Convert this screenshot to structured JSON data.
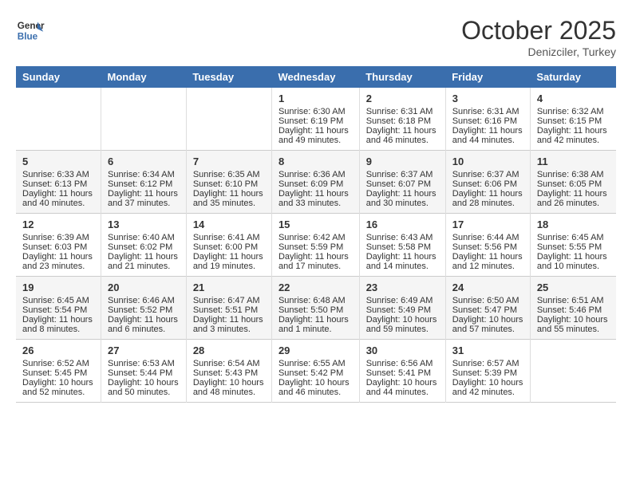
{
  "header": {
    "logo_line1": "General",
    "logo_line2": "Blue",
    "month": "October 2025",
    "location": "Denizciler, Turkey"
  },
  "days_of_week": [
    "Sunday",
    "Monday",
    "Tuesday",
    "Wednesday",
    "Thursday",
    "Friday",
    "Saturday"
  ],
  "weeks": [
    [
      {
        "day": "",
        "sunrise": "",
        "sunset": "",
        "daylight": ""
      },
      {
        "day": "",
        "sunrise": "",
        "sunset": "",
        "daylight": ""
      },
      {
        "day": "",
        "sunrise": "",
        "sunset": "",
        "daylight": ""
      },
      {
        "day": "1",
        "sunrise": "Sunrise: 6:30 AM",
        "sunset": "Sunset: 6:19 PM",
        "daylight": "Daylight: 11 hours and 49 minutes."
      },
      {
        "day": "2",
        "sunrise": "Sunrise: 6:31 AM",
        "sunset": "Sunset: 6:18 PM",
        "daylight": "Daylight: 11 hours and 46 minutes."
      },
      {
        "day": "3",
        "sunrise": "Sunrise: 6:31 AM",
        "sunset": "Sunset: 6:16 PM",
        "daylight": "Daylight: 11 hours and 44 minutes."
      },
      {
        "day": "4",
        "sunrise": "Sunrise: 6:32 AM",
        "sunset": "Sunset: 6:15 PM",
        "daylight": "Daylight: 11 hours and 42 minutes."
      }
    ],
    [
      {
        "day": "5",
        "sunrise": "Sunrise: 6:33 AM",
        "sunset": "Sunset: 6:13 PM",
        "daylight": "Daylight: 11 hours and 40 minutes."
      },
      {
        "day": "6",
        "sunrise": "Sunrise: 6:34 AM",
        "sunset": "Sunset: 6:12 PM",
        "daylight": "Daylight: 11 hours and 37 minutes."
      },
      {
        "day": "7",
        "sunrise": "Sunrise: 6:35 AM",
        "sunset": "Sunset: 6:10 PM",
        "daylight": "Daylight: 11 hours and 35 minutes."
      },
      {
        "day": "8",
        "sunrise": "Sunrise: 6:36 AM",
        "sunset": "Sunset: 6:09 PM",
        "daylight": "Daylight: 11 hours and 33 minutes."
      },
      {
        "day": "9",
        "sunrise": "Sunrise: 6:37 AM",
        "sunset": "Sunset: 6:07 PM",
        "daylight": "Daylight: 11 hours and 30 minutes."
      },
      {
        "day": "10",
        "sunrise": "Sunrise: 6:37 AM",
        "sunset": "Sunset: 6:06 PM",
        "daylight": "Daylight: 11 hours and 28 minutes."
      },
      {
        "day": "11",
        "sunrise": "Sunrise: 6:38 AM",
        "sunset": "Sunset: 6:05 PM",
        "daylight": "Daylight: 11 hours and 26 minutes."
      }
    ],
    [
      {
        "day": "12",
        "sunrise": "Sunrise: 6:39 AM",
        "sunset": "Sunset: 6:03 PM",
        "daylight": "Daylight: 11 hours and 23 minutes."
      },
      {
        "day": "13",
        "sunrise": "Sunrise: 6:40 AM",
        "sunset": "Sunset: 6:02 PM",
        "daylight": "Daylight: 11 hours and 21 minutes."
      },
      {
        "day": "14",
        "sunrise": "Sunrise: 6:41 AM",
        "sunset": "Sunset: 6:00 PM",
        "daylight": "Daylight: 11 hours and 19 minutes."
      },
      {
        "day": "15",
        "sunrise": "Sunrise: 6:42 AM",
        "sunset": "Sunset: 5:59 PM",
        "daylight": "Daylight: 11 hours and 17 minutes."
      },
      {
        "day": "16",
        "sunrise": "Sunrise: 6:43 AM",
        "sunset": "Sunset: 5:58 PM",
        "daylight": "Daylight: 11 hours and 14 minutes."
      },
      {
        "day": "17",
        "sunrise": "Sunrise: 6:44 AM",
        "sunset": "Sunset: 5:56 PM",
        "daylight": "Daylight: 11 hours and 12 minutes."
      },
      {
        "day": "18",
        "sunrise": "Sunrise: 6:45 AM",
        "sunset": "Sunset: 5:55 PM",
        "daylight": "Daylight: 11 hours and 10 minutes."
      }
    ],
    [
      {
        "day": "19",
        "sunrise": "Sunrise: 6:45 AM",
        "sunset": "Sunset: 5:54 PM",
        "daylight": "Daylight: 11 hours and 8 minutes."
      },
      {
        "day": "20",
        "sunrise": "Sunrise: 6:46 AM",
        "sunset": "Sunset: 5:52 PM",
        "daylight": "Daylight: 11 hours and 6 minutes."
      },
      {
        "day": "21",
        "sunrise": "Sunrise: 6:47 AM",
        "sunset": "Sunset: 5:51 PM",
        "daylight": "Daylight: 11 hours and 3 minutes."
      },
      {
        "day": "22",
        "sunrise": "Sunrise: 6:48 AM",
        "sunset": "Sunset: 5:50 PM",
        "daylight": "Daylight: 11 hours and 1 minute."
      },
      {
        "day": "23",
        "sunrise": "Sunrise: 6:49 AM",
        "sunset": "Sunset: 5:49 PM",
        "daylight": "Daylight: 10 hours and 59 minutes."
      },
      {
        "day": "24",
        "sunrise": "Sunrise: 6:50 AM",
        "sunset": "Sunset: 5:47 PM",
        "daylight": "Daylight: 10 hours and 57 minutes."
      },
      {
        "day": "25",
        "sunrise": "Sunrise: 6:51 AM",
        "sunset": "Sunset: 5:46 PM",
        "daylight": "Daylight: 10 hours and 55 minutes."
      }
    ],
    [
      {
        "day": "26",
        "sunrise": "Sunrise: 6:52 AM",
        "sunset": "Sunset: 5:45 PM",
        "daylight": "Daylight: 10 hours and 52 minutes."
      },
      {
        "day": "27",
        "sunrise": "Sunrise: 6:53 AM",
        "sunset": "Sunset: 5:44 PM",
        "daylight": "Daylight: 10 hours and 50 minutes."
      },
      {
        "day": "28",
        "sunrise": "Sunrise: 6:54 AM",
        "sunset": "Sunset: 5:43 PM",
        "daylight": "Daylight: 10 hours and 48 minutes."
      },
      {
        "day": "29",
        "sunrise": "Sunrise: 6:55 AM",
        "sunset": "Sunset: 5:42 PM",
        "daylight": "Daylight: 10 hours and 46 minutes."
      },
      {
        "day": "30",
        "sunrise": "Sunrise: 6:56 AM",
        "sunset": "Sunset: 5:41 PM",
        "daylight": "Daylight: 10 hours and 44 minutes."
      },
      {
        "day": "31",
        "sunrise": "Sunrise: 6:57 AM",
        "sunset": "Sunset: 5:39 PM",
        "daylight": "Daylight: 10 hours and 42 minutes."
      },
      {
        "day": "",
        "sunrise": "",
        "sunset": "",
        "daylight": ""
      }
    ]
  ]
}
